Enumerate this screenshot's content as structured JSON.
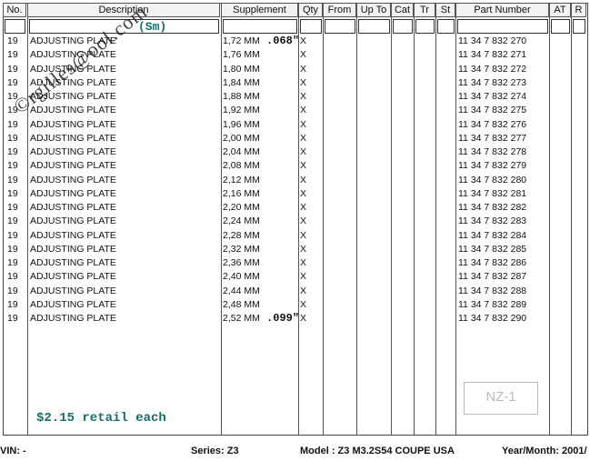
{
  "columns": [
    "No.",
    "Description",
    "Supplement",
    "Qty",
    "From",
    "Up To",
    "Cat",
    "Tr",
    "St",
    "Part Number",
    "AT",
    "R"
  ],
  "rows": [
    {
      "no": "19",
      "desc": "ADJUSTING PLATE",
      "sup": "1,72 MM",
      "note": ".068\"",
      "qty": "X",
      "pn": "11 34 7 832 270"
    },
    {
      "no": "19",
      "desc": "ADJUSTING PLATE",
      "sup": "1,76 MM",
      "note": "",
      "qty": "X",
      "pn": "11 34 7 832 271"
    },
    {
      "no": "19",
      "desc": "ADJUSTING PLATE",
      "sup": "1,80 MM",
      "note": "",
      "qty": "X",
      "pn": "11 34 7 832 272"
    },
    {
      "no": "19",
      "desc": "ADJUSTING PLATE",
      "sup": "1,84 MM",
      "note": "",
      "qty": "X",
      "pn": "11 34 7 832 273"
    },
    {
      "no": "19",
      "desc": "ADJUSTING PLATE",
      "sup": "1,88 MM",
      "note": "",
      "qty": "X",
      "pn": "11 34 7 832 274"
    },
    {
      "no": "19",
      "desc": "ADJUSTING PLATE",
      "sup": "1,92 MM",
      "note": "",
      "qty": "X",
      "pn": "11 34 7 832 275"
    },
    {
      "no": "19",
      "desc": "ADJUSTING PLATE",
      "sup": "1,96 MM",
      "note": "",
      "qty": "X",
      "pn": "11 34 7 832 276"
    },
    {
      "no": "19",
      "desc": "ADJUSTING PLATE",
      "sup": "2,00 MM",
      "note": "",
      "qty": "X",
      "pn": "11 34 7 832 277"
    },
    {
      "no": "19",
      "desc": "ADJUSTING PLATE",
      "sup": "2,04 MM",
      "note": "",
      "qty": "X",
      "pn": "11 34 7 832 278"
    },
    {
      "no": "19",
      "desc": "ADJUSTING PLATE",
      "sup": "2,08 MM",
      "note": "",
      "qty": "X",
      "pn": "11 34 7 832 279"
    },
    {
      "no": "19",
      "desc": "ADJUSTING PLATE",
      "sup": "2,12 MM",
      "note": "",
      "qty": "X",
      "pn": "11 34 7 832 280"
    },
    {
      "no": "19",
      "desc": "ADJUSTING PLATE",
      "sup": "2,16 MM",
      "note": "",
      "qty": "X",
      "pn": "11 34 7 832 281"
    },
    {
      "no": "19",
      "desc": "ADJUSTING PLATE",
      "sup": "2,20 MM",
      "note": "",
      "qty": "X",
      "pn": "11 34 7 832 282"
    },
    {
      "no": "19",
      "desc": "ADJUSTING PLATE",
      "sup": "2,24 MM",
      "note": "",
      "qty": "X",
      "pn": "11 34 7 832 283"
    },
    {
      "no": "19",
      "desc": "ADJUSTING PLATE",
      "sup": "2,28 MM",
      "note": "",
      "qty": "X",
      "pn": "11 34 7 832 284"
    },
    {
      "no": "19",
      "desc": "ADJUSTING PLATE",
      "sup": "2,32 MM",
      "note": "",
      "qty": "X",
      "pn": "11 34 7 832 285"
    },
    {
      "no": "19",
      "desc": "ADJUSTING PLATE",
      "sup": "2,36 MM",
      "note": "",
      "qty": "X",
      "pn": "11 34 7 832 286"
    },
    {
      "no": "19",
      "desc": "ADJUSTING PLATE",
      "sup": "2,40 MM",
      "note": "",
      "qty": "X",
      "pn": "11 34 7 832 287"
    },
    {
      "no": "19",
      "desc": "ADJUSTING PLATE",
      "sup": "2,44 MM",
      "note": "",
      "qty": "X",
      "pn": "11 34 7 832 288"
    },
    {
      "no": "19",
      "desc": "ADJUSTING PLATE",
      "sup": "2,48 MM",
      "note": "",
      "qty": "X",
      "pn": "11 34 7 832 289"
    },
    {
      "no": "19",
      "desc": "ADJUSTING PLATE",
      "sup": "2,52 MM",
      "note": ".099\"",
      "qty": "X",
      "pn": "11 34 7 832 290"
    }
  ],
  "annotations": {
    "size_note": "(Sm)",
    "retail": "$2.15 retail each",
    "watermark": "©rgilles@ool.com",
    "stamp": "NZ-1"
  },
  "footer": {
    "vin": "VIN: -",
    "series": "Series: Z3",
    "model": "Model : Z3 M3.2S54 COUPE USA",
    "year": "Year/Month: 2001/"
  }
}
